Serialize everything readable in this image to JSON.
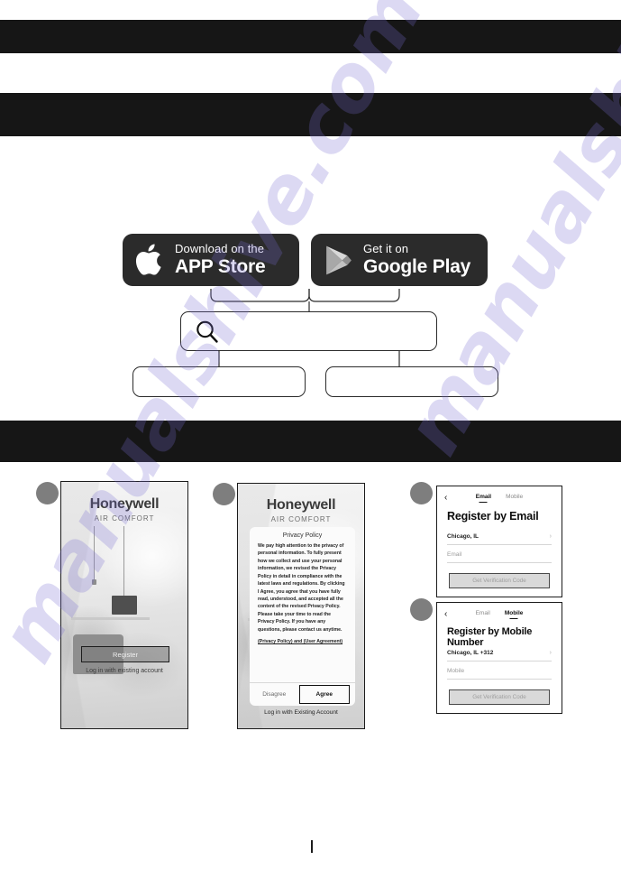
{
  "document": {
    "watermark": "manualshive.com",
    "redacted_bars": [
      "",
      "",
      ""
    ]
  },
  "store_badges": {
    "apple": {
      "icon": "apple-icon",
      "small": "Download on the",
      "big": "APP Store"
    },
    "google": {
      "icon": "google-play-icon",
      "small": "Get it on",
      "big": "Google Play"
    }
  },
  "flow": {
    "search_box": {
      "icon": "search-icon",
      "value": "",
      "placeholder": ""
    },
    "option_left": "",
    "option_right": ""
  },
  "steps": [
    {
      "marker": "",
      "id": "step-1"
    },
    {
      "marker": "",
      "id": "step-2"
    },
    {
      "marker": "",
      "id": "step-3"
    },
    {
      "marker": "",
      "id": "step-4"
    }
  ],
  "panel1": {
    "brand": "Honeywell",
    "subbrand": "AIR COMFORT",
    "register_button": "Register",
    "login_link": "Log in with existing account"
  },
  "panel2": {
    "brand": "Honeywell",
    "subbrand": "AIR COMFORT",
    "dialog": {
      "title": "Privacy Policy",
      "body": "We pay high attention to the privacy of personal information. To fully present how we collect and use your personal information, we revised the Privacy Policy in detail in compliance with the latest laws and regulations. By clicking I Agree, you agree that you have fully read, understood, and accepted all the content of the revised Privacy Policy. Please take your time to read the Privacy Policy. If you have any questions, please contact us anytime.",
      "links": "(Privacy Policy)  and  (User Agreement)",
      "disagree": "Disagree",
      "agree": "Agree"
    },
    "login_link": "Log in with Existing Account"
  },
  "panel3": {
    "back": "‹",
    "tab_email": "Email",
    "tab_mobile": "Mobile",
    "title": "Register by Email",
    "region": "Chicago, IL",
    "chevron": "›",
    "input_placeholder": "Email",
    "cta": "Get Verification Code"
  },
  "panel4": {
    "back": "‹",
    "tab_email": "Email",
    "tab_mobile": "Mobile",
    "title": "Register by Mobile Number",
    "region": "Chicago, IL +312",
    "chevron": "›",
    "input_placeholder": "Mobile",
    "cta": "Get Verification Code"
  },
  "colors": {
    "redaction": "#161616",
    "badge_bg": "#2b2b2b",
    "marker": "#7e7e7e",
    "watermark": "#786ed2"
  }
}
